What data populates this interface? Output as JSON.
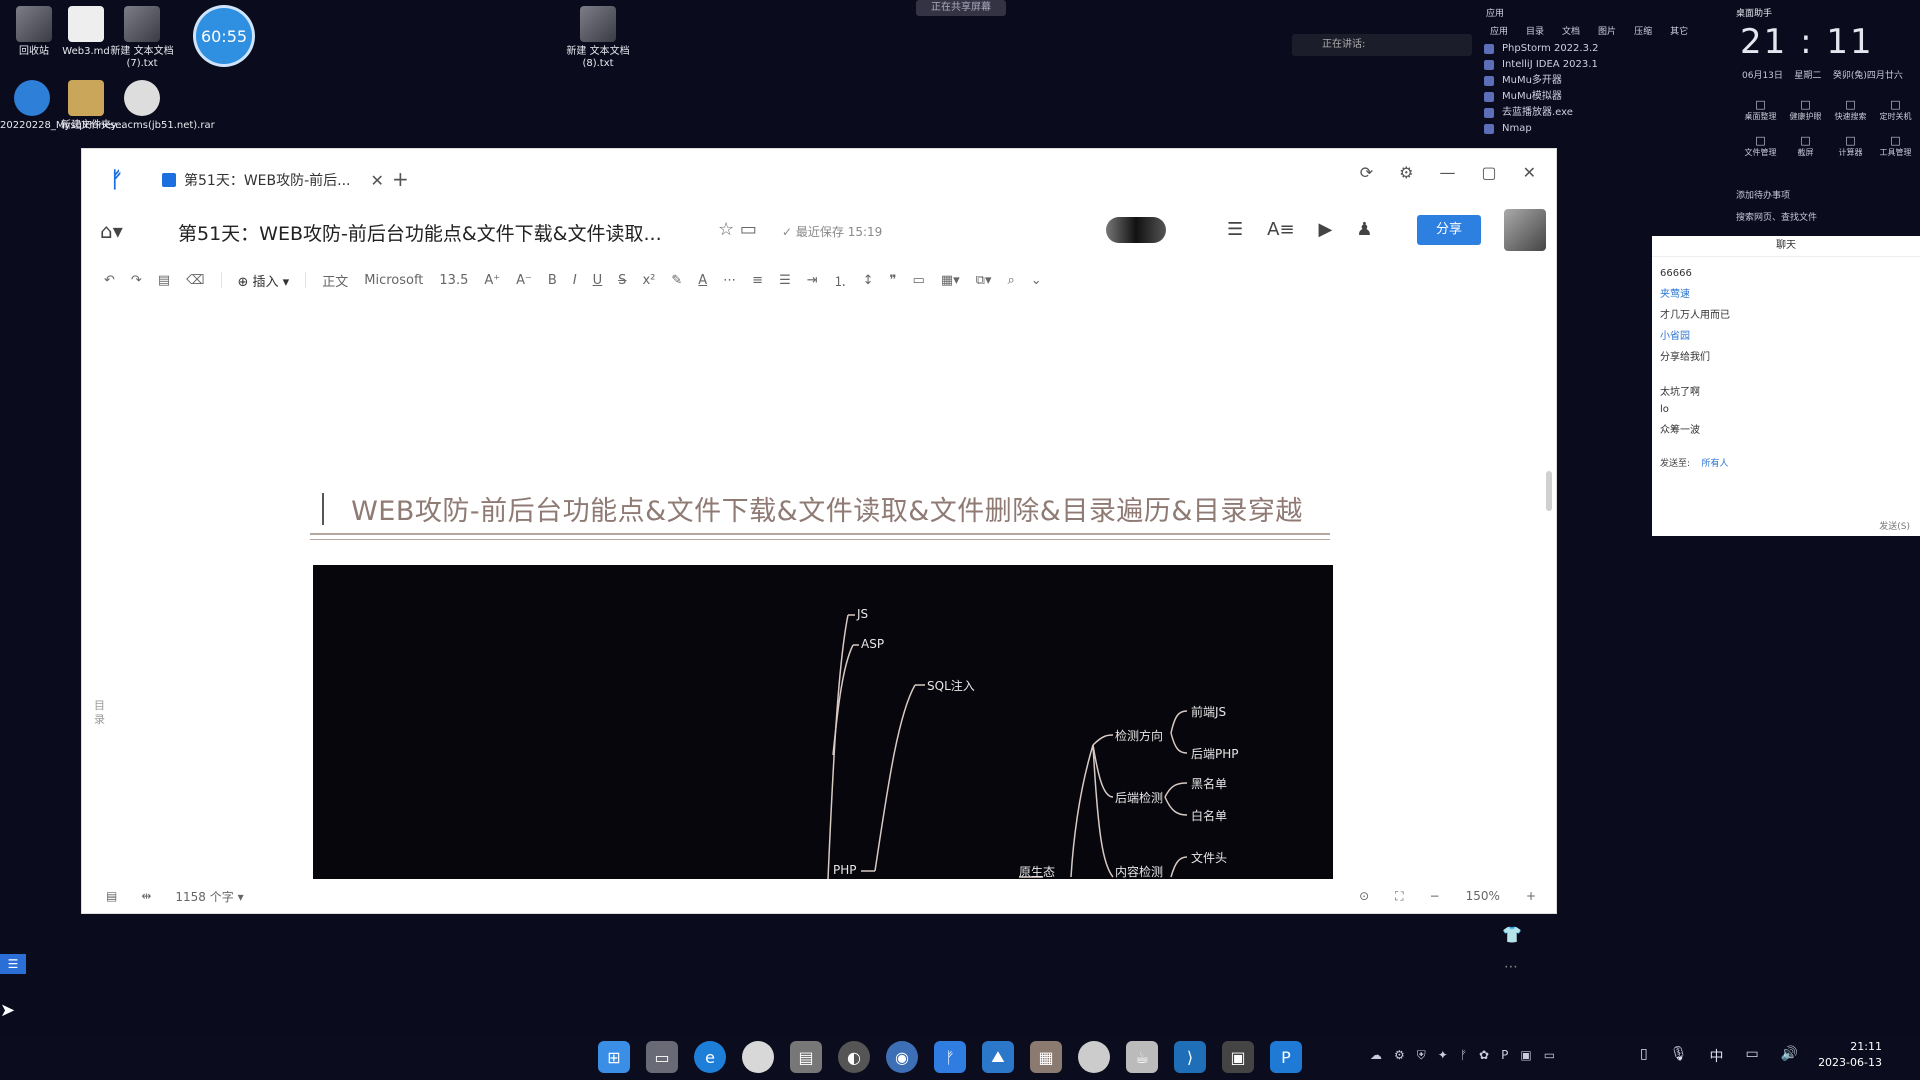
{
  "desktop": {
    "icons": [
      {
        "label": "回收站"
      },
      {
        "label": "Web3.md"
      },
      {
        "label": "新建 文本文档 (7).txt"
      },
      {
        "label": "20220228_MysqlHoney..."
      },
      {
        "label": "新建文件夹"
      },
      {
        "label": "seacms(jb51.net).rar"
      },
      {
        "label": "新建 文本文档 (8).txt"
      }
    ],
    "timer": "60:55",
    "rec_chip": "正在共享屏幕",
    "speak_bar": "正在讲话:"
  },
  "apps_panel": {
    "header": "应用",
    "categories": [
      "应用",
      "目录",
      "文档",
      "图片",
      "压缩",
      "其它"
    ],
    "items": [
      "PhpStorm 2022.3.2",
      "IntelliJ IDEA 2023.1",
      "MuMu多开器",
      "MuMu模拟器",
      "去蓝播放器.exe",
      "Nmap"
    ]
  },
  "clock_panel": {
    "header": "桌面助手",
    "time": "21 : 11",
    "date_left": "06月13日",
    "weekday": "星期二",
    "lunar": "癸卯(兔)四月廿六",
    "quick": [
      "桌面整理",
      "健康护眼",
      "快速搜索",
      "定时关机",
      "文件管理",
      "截屏",
      "计算器",
      "工具管理"
    ],
    "todo": "添加待办事项",
    "search_hint": "搜索网页、查找文件"
  },
  "chat": {
    "title": "聊天",
    "messages": [
      {
        "text": "66666",
        "user": false
      },
      {
        "text": "夹莺速",
        "user": true
      },
      {
        "text": "才几万人用而已",
        "user": false
      },
      {
        "text": "小省园",
        "user": true
      },
      {
        "text": "分享给我们",
        "user": false
      },
      {
        "text": "太坑了啊",
        "user": false
      },
      {
        "text": "lo",
        "user": false
      },
      {
        "text": "众筹一波",
        "user": false
      }
    ],
    "send_to_label": "发送至:",
    "send_to_value": "所有人",
    "send_button": "发送(S)"
  },
  "editor": {
    "tab_title": "第51天：WEB攻防-前后...",
    "doc_title": "第51天：WEB攻防-前后台功能点&文件下载&文件读取...",
    "saved_status": "最近保存 15:19",
    "share_label": "分享",
    "toolbar": {
      "insert": "插入",
      "text_style": "正文",
      "font": "Microsoft",
      "font_size": "13.5"
    },
    "heading": "WEB攻防-前后台功能点&文件下载&文件读取&文件删除&目录遍历&目录穿越",
    "toc_label": "目录",
    "word_count": "1158 个字",
    "zoom": "150%"
  },
  "mindmap": {
    "nodes": [
      "JS",
      "ASP",
      "SQL注入",
      "检测方向",
      "前端JS",
      "后端PHP",
      "后端检测",
      "黑名单",
      "白名单",
      "PHP",
      "原生态",
      "内容检测",
      "文件头"
    ]
  },
  "taskbar": {
    "time": "21:11",
    "date": "2023-06-13",
    "ime": "中"
  }
}
